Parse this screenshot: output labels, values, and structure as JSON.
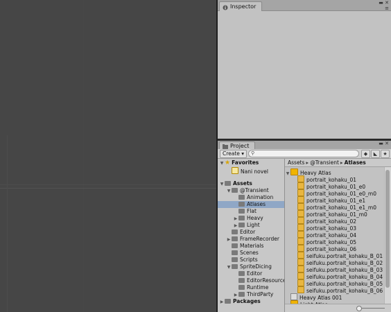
{
  "inspector": {
    "tab_label": "Inspector"
  },
  "project": {
    "tab_label": "Project",
    "create_label": "Create",
    "search_value": "",
    "tree": [
      {
        "label": "Favorites",
        "level": 0,
        "kind": "star",
        "arrow": "▼",
        "bold": true
      },
      {
        "label": "Nani novel",
        "level": 1,
        "kind": "fav",
        "arrow": ""
      },
      {
        "label": "",
        "level": 0,
        "kind": "blank",
        "arrow": ""
      },
      {
        "label": "Assets",
        "level": 0,
        "kind": "folder",
        "arrow": "▼",
        "bold": true
      },
      {
        "label": "@Transient",
        "level": 1,
        "kind": "folder",
        "arrow": "▼"
      },
      {
        "label": "Animation",
        "level": 2,
        "kind": "folder",
        "arrow": ""
      },
      {
        "label": "Atlases",
        "level": 2,
        "kind": "folder",
        "arrow": "",
        "selected": true
      },
      {
        "label": "Flat",
        "level": 2,
        "kind": "folder",
        "arrow": ""
      },
      {
        "label": "Heavy",
        "level": 2,
        "kind": "folder",
        "arrow": "▶"
      },
      {
        "label": "Light",
        "level": 2,
        "kind": "folder",
        "arrow": "▶"
      },
      {
        "label": "Editor",
        "level": 1,
        "kind": "folder",
        "arrow": ""
      },
      {
        "label": "FrameRecorder",
        "level": 1,
        "kind": "folder",
        "arrow": "▶"
      },
      {
        "label": "Materials",
        "level": 1,
        "kind": "folder",
        "arrow": ""
      },
      {
        "label": "Scenes",
        "level": 1,
        "kind": "folder",
        "arrow": ""
      },
      {
        "label": "Scripts",
        "level": 1,
        "kind": "folder",
        "arrow": ""
      },
      {
        "label": "SpriteDicing",
        "level": 1,
        "kind": "folder",
        "arrow": "▼"
      },
      {
        "label": "Editor",
        "level": 2,
        "kind": "folder",
        "arrow": ""
      },
      {
        "label": "EditorResources",
        "level": 2,
        "kind": "folder",
        "arrow": ""
      },
      {
        "label": "Runtime",
        "level": 2,
        "kind": "folder",
        "arrow": ""
      },
      {
        "label": "ThirdParty",
        "level": 2,
        "kind": "folder",
        "arrow": "▶"
      },
      {
        "label": "Packages",
        "level": 0,
        "kind": "folder",
        "arrow": "▶",
        "bold": true
      }
    ],
    "breadcrumb": [
      "Assets",
      "@Transient",
      "Atlases"
    ],
    "files": [
      {
        "label": "Heavy Atlas",
        "level": 0,
        "kind": "atlas",
        "arrow": "▼"
      },
      {
        "label": "portrait_kohaku_01",
        "level": 1,
        "kind": "sprite"
      },
      {
        "label": "portrait_kohaku_01_e0",
        "level": 1,
        "kind": "sprite"
      },
      {
        "label": "portrait_kohaku_01_e0_m0",
        "level": 1,
        "kind": "sprite"
      },
      {
        "label": "portrait_kohaku_01_e1",
        "level": 1,
        "kind": "sprite"
      },
      {
        "label": "portrait_kohaku_01_e1_m0",
        "level": 1,
        "kind": "sprite"
      },
      {
        "label": "portrait_kohaku_01_m0",
        "level": 1,
        "kind": "sprite"
      },
      {
        "label": "portrait_kohaku_02",
        "level": 1,
        "kind": "sprite"
      },
      {
        "label": "portrait_kohaku_03",
        "level": 1,
        "kind": "sprite"
      },
      {
        "label": "portrait_kohaku_04",
        "level": 1,
        "kind": "sprite"
      },
      {
        "label": "portrait_kohaku_05",
        "level": 1,
        "kind": "sprite"
      },
      {
        "label": "portrait_kohaku_06",
        "level": 1,
        "kind": "sprite"
      },
      {
        "label": "seifuku.portrait_kohaku_B_01",
        "level": 1,
        "kind": "sprite"
      },
      {
        "label": "seifuku.portrait_kohaku_B_02",
        "level": 1,
        "kind": "sprite"
      },
      {
        "label": "seifuku.portrait_kohaku_B_03",
        "level": 1,
        "kind": "sprite"
      },
      {
        "label": "seifuku.portrait_kohaku_B_04",
        "level": 1,
        "kind": "sprite"
      },
      {
        "label": "seifuku.portrait_kohaku_B_05",
        "level": 1,
        "kind": "sprite"
      },
      {
        "label": "seifuku.portrait_kohaku_B_06",
        "level": 1,
        "kind": "sprite"
      },
      {
        "label": "Heavy Atlas 001",
        "level": 0,
        "kind": "variant",
        "arrow": ""
      },
      {
        "label": "Light Atlas",
        "level": 0,
        "kind": "atlas",
        "arrow": "▶"
      }
    ]
  },
  "colors": {
    "selection": "#8fa7c6",
    "panel": "#c2c2c2",
    "scene": "#464646"
  }
}
